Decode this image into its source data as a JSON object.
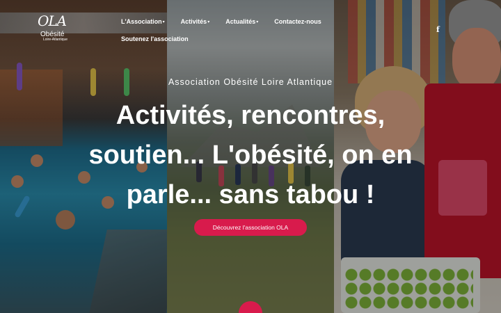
{
  "brand": {
    "logo_mark": "OLA",
    "logo_line1": "Obésité",
    "logo_line2": "Loire-Atlantique"
  },
  "nav": {
    "items": [
      {
        "label": "L'Association",
        "has_dropdown": true
      },
      {
        "label": "Activités",
        "has_dropdown": true
      },
      {
        "label": "Actualités",
        "has_dropdown": true
      },
      {
        "label": "Contactez-nous",
        "has_dropdown": false
      },
      {
        "label": "Soutenez l'association",
        "has_dropdown": false
      }
    ],
    "caret": "▾",
    "social_icon": "facebook-icon",
    "social_glyph": "f"
  },
  "hero": {
    "eyebrow": "Association Obésité Loire Atlantique",
    "headline_line1": "Activités, rencontres,",
    "headline_line2": "soutien... L'obésité, on en",
    "headline_line3": "parle... sans tabou !",
    "cta_label": "Découvrez l'association OLA"
  },
  "colors": {
    "accent": "#d81b4c",
    "text": "#ffffff"
  }
}
